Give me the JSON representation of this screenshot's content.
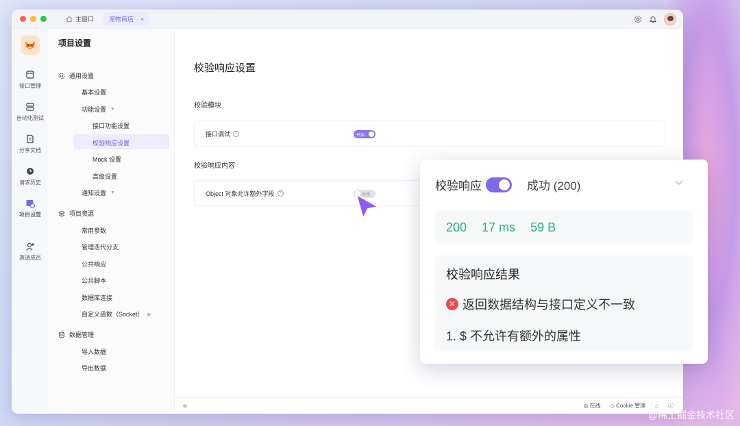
{
  "titlebar": {
    "home_tab": "主窗口",
    "active_tab": "宠物商店",
    "close_glyph": "×"
  },
  "rail": {
    "items": [
      {
        "label": "接口管理",
        "icon": "api-icon"
      },
      {
        "label": "自动化测试",
        "icon": "automation-icon"
      },
      {
        "label": "分享文档",
        "icon": "document-icon"
      },
      {
        "label": "请求历史",
        "icon": "history-icon"
      },
      {
        "label": "项目设置",
        "icon": "settings-icon"
      },
      {
        "label": "邀请成员",
        "icon": "invite-icon"
      }
    ]
  },
  "sidebar": {
    "title": "项目设置",
    "general": "通用设置",
    "basic": "基本设置",
    "features": "功能设置",
    "api_features": "接口功能设置",
    "validate_response": "校验响应设置",
    "mock": "Mock 设置",
    "advanced": "高级设置",
    "notify": "通知设置",
    "resources": "项目资源",
    "params": "常用参数",
    "iterations": "管理迭代分支",
    "public_response": "公共响应",
    "public_scripts": "公共脚本",
    "db_conn": "数据库连接",
    "custom_func": "自定义函数（Socket）",
    "data_mgmt": "数据管理",
    "import": "导入数据",
    "export": "导出数据"
  },
  "main": {
    "title": "校验响应设置",
    "section1": "校验模块",
    "row1_label": "接口调试",
    "row1_toggle": "开启",
    "section2": "校验响应内容",
    "row2_label": "Object 对象允许额外字段",
    "row2_toggle": "关闭"
  },
  "statusbar": {
    "online": "在线",
    "cookie": "Cookie 管理"
  },
  "popover": {
    "label": "校验响应",
    "status": "成功 (200)",
    "code": "200",
    "time": "17 ms",
    "size": "59 B",
    "result_title": "校验响应结果",
    "error_msg": "返回数据结构与接口定义不一致",
    "detail": "1. $ 不允许有额外的属性"
  },
  "watermark": "@稀土掘金技术社区",
  "colors": {
    "accent": "#7b6ae6",
    "success": "#26b37a",
    "error": "#ef4b4b"
  }
}
